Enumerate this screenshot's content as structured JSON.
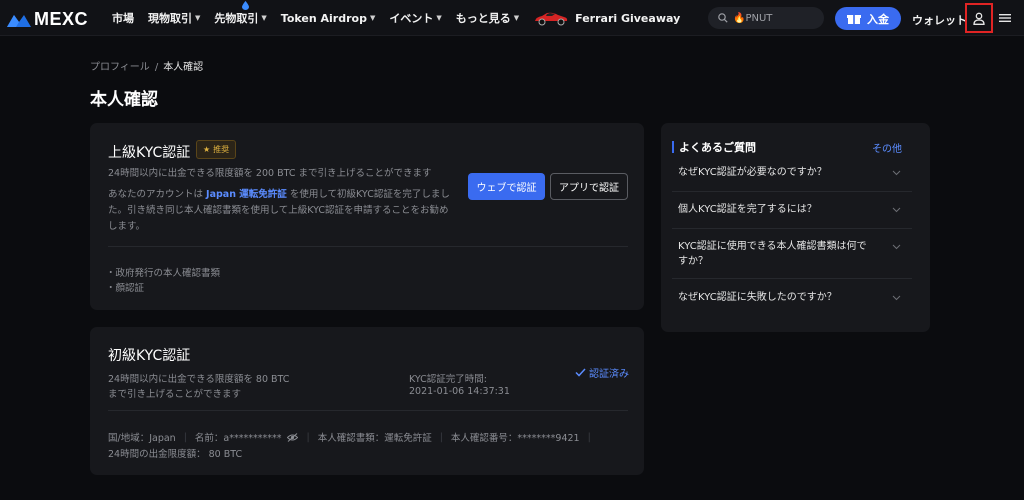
{
  "nav": {
    "logo_text": "MEXC",
    "items": [
      {
        "label": "市場",
        "has_caret": false
      },
      {
        "label": "現物取引",
        "has_caret": true
      },
      {
        "label": "先物取引",
        "has_caret": true
      },
      {
        "label": "Token Airdrop",
        "has_caret": true
      },
      {
        "label": "イベント",
        "has_caret": true
      },
      {
        "label": "もっと見る",
        "has_caret": true
      }
    ],
    "promo_label": "Ferrari Giveaway",
    "search_placeholder": "🔥PNUT",
    "deposit_label": "入金",
    "wallet_label": "ウォレット",
    "accent_color": "#3a6bf0"
  },
  "breadcrumb": {
    "parent": "プロフィール",
    "separator": "/",
    "current": "本人確認"
  },
  "page_title": "本人確認",
  "advanced_kyc": {
    "title": "上級KYC認証",
    "badge": "推奨",
    "limit_text": "24時間以内に出金できる限度額を 200 BTC まで引き上げることができます",
    "desc_pre": "あなたのアカウントは",
    "desc_highlight": "Japan 運転免許証",
    "desc_post_line1": "を使用して初級KYC認証を完了しまし",
    "desc_line2": "た。引き続き同じ本人確認書類を使用して上級KYC認証を申請することをお勧め",
    "desc_line3": "します。",
    "web_button": "ウェブで認証",
    "app_button": "アプリで認証",
    "requirements": [
      "・政府発行の本人確認書類",
      "・顔認証"
    ]
  },
  "basic_kyc": {
    "title": "初級KYC認証",
    "limit_line1": "24時間以内に出金できる限度額を 80 BTC",
    "limit_line2": "まで引き上げることができます",
    "completed_label": "KYC認証完了時間:",
    "completed_time": "2021-01-06 14:37:31",
    "status": "認証済み",
    "country": "国/地域：Japan",
    "name": "名前：a***********",
    "doc_type": "本人確認書類：運転免許証",
    "doc_number": "本人確認番号：********9421",
    "daily_limit": "24時間の出金限度額： 80 BTC"
  },
  "faq": {
    "title": "よくあるご質問",
    "more": "その他",
    "questions": [
      "なぜKYC認証が必要なのですか？",
      "個人KYC認証を完了するには？",
      "KYC認証に使用できる本人確認書類は何ですか？",
      "なぜKYC認証に失敗したのですか？"
    ]
  }
}
